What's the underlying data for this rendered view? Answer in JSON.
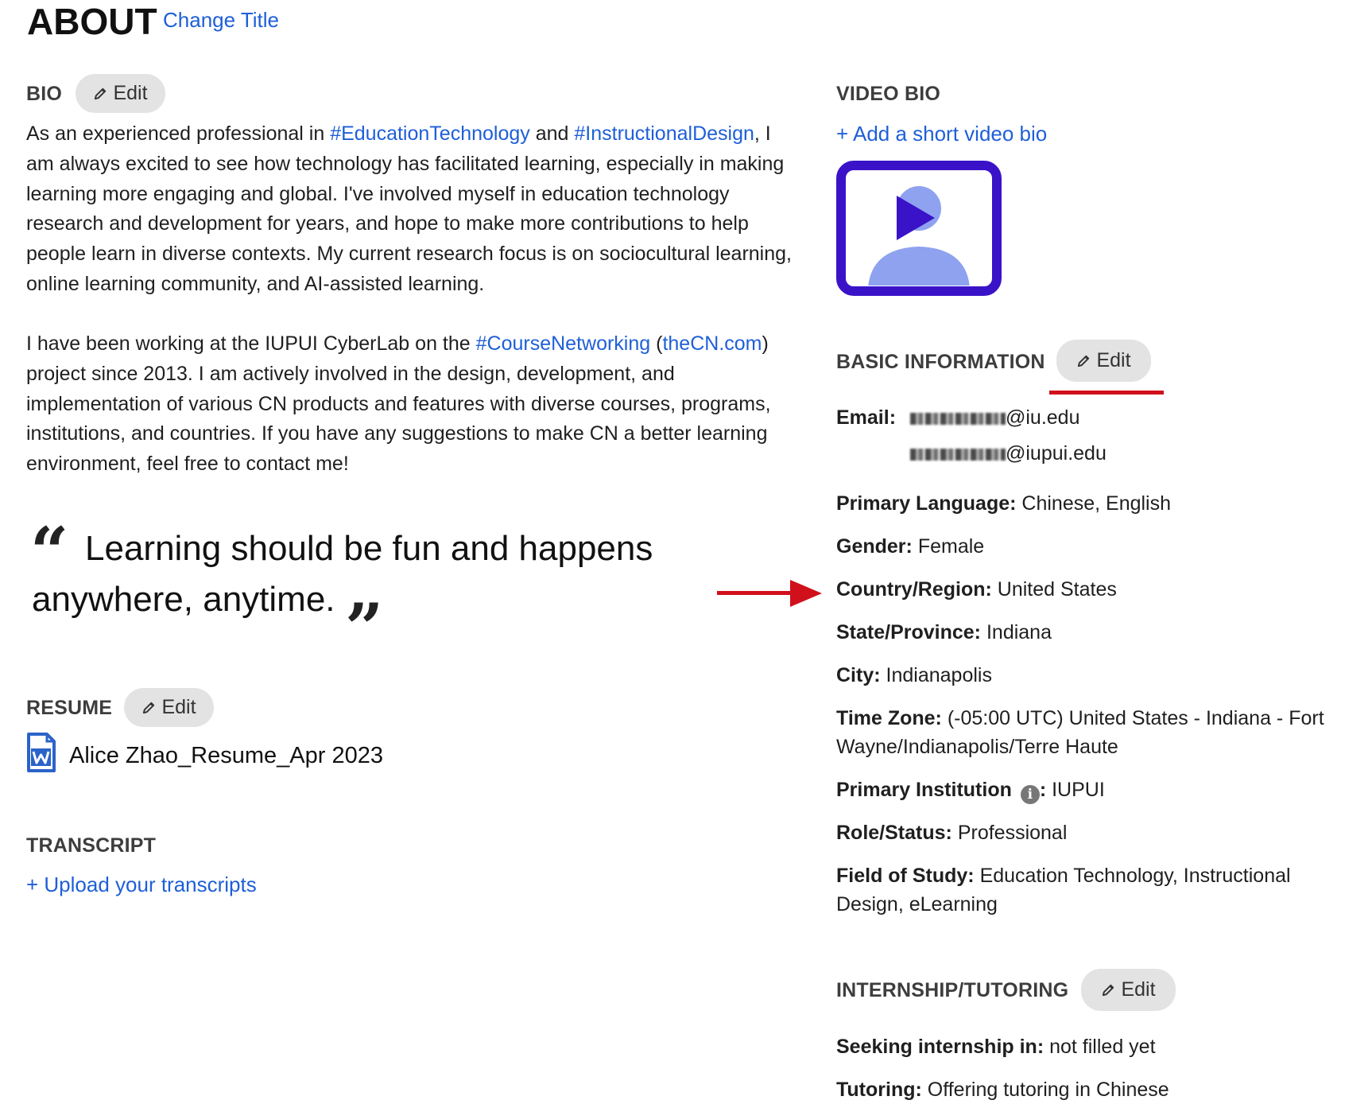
{
  "header": {
    "title": "ABOUT",
    "change_title": "Change Title"
  },
  "bio": {
    "section_title": "BIO",
    "edit_label": "Edit",
    "p1": [
      {
        "t": "As an experienced professional in ",
        "link": false
      },
      {
        "t": "#EducationTechnology",
        "link": true
      },
      {
        "t": " and ",
        "link": false
      },
      {
        "t": "#InstructionalDesign",
        "link": true
      },
      {
        "t": ", I am always excited to see how technology has facilitated learning, especially in making learning more engaging and global. I've involved myself in education technology research and development for years, and hope to make more contributions to help people learn in diverse contexts. My current research focus is on sociocultural learning, online learning community, and AI-assisted learning.",
        "link": false
      }
    ],
    "p2": [
      {
        "t": "I have been working at the IUPUI CyberLab on the ",
        "link": false
      },
      {
        "t": "#CourseNetworking",
        "link": true
      },
      {
        "t": " (",
        "link": false
      },
      {
        "t": "theCN.com",
        "link": true
      },
      {
        "t": ") project since 2013. I am actively involved in the design, development, and implementation of various CN products and features with diverse courses, programs, institutions, and countries. If you have any suggestions to make CN a better learning environment, feel free to contact me!",
        "link": false
      }
    ]
  },
  "quote": {
    "line1": "Learning should be fun and happens",
    "line2": "anywhere, anytime."
  },
  "resume": {
    "section_title": "RESUME",
    "edit_label": "Edit",
    "file_name": "Alice Zhao_Resume_Apr 2023"
  },
  "transcript": {
    "section_title": "TRANSCRIPT",
    "upload_link": "+ Upload your transcripts"
  },
  "video_bio": {
    "section_title": "VIDEO BIO",
    "add_link": "+ Add a short video bio"
  },
  "basic_info": {
    "section_title": "BASIC INFORMATION",
    "edit_label": "Edit",
    "email_label": "Email:",
    "email_1_suffix": "@iu.edu",
    "email_2_suffix": "@iupui.edu",
    "primary_language_label": "Primary Language:",
    "primary_language": "Chinese, English",
    "gender_label": "Gender:",
    "gender": "Female",
    "country_label": "Country/Region:",
    "country": "United States",
    "state_label": "State/Province:",
    "state": "Indiana",
    "city_label": "City:",
    "city": "Indianapolis",
    "timezone_label": "Time Zone:",
    "timezone_line1": "(-05:00 UTC) United States - Indiana - Fort",
    "timezone_line2": "Wayne/Indianapolis/Terre Haute",
    "institution_label": "Primary Institution",
    "institution": "IUPUI",
    "role_label": "Role/Status:",
    "role": "Professional",
    "field_label": "Field of Study:",
    "field_line1": "Education Technology, Instructional",
    "field_line2": "Design, eLearning"
  },
  "internship": {
    "section_title": "INTERNSHIP/TUTORING",
    "edit_label": "Edit",
    "seeking_label": "Seeking internship in:",
    "seeking": "not filled yet",
    "tutoring_label": "Tutoring:",
    "tutoring": "Offering tutoring in Chinese"
  },
  "colors": {
    "link": "#1e5fd8",
    "annotation_red": "#d0101b",
    "video_frame": "#3a13c9",
    "video_person": "#8ea2f0",
    "word_icon": "#2b63c9"
  },
  "icons": [
    "pencil-icon",
    "video-placeholder-icon",
    "word-file-icon",
    "info-icon",
    "open-quote-icon",
    "close-quote-icon"
  ]
}
